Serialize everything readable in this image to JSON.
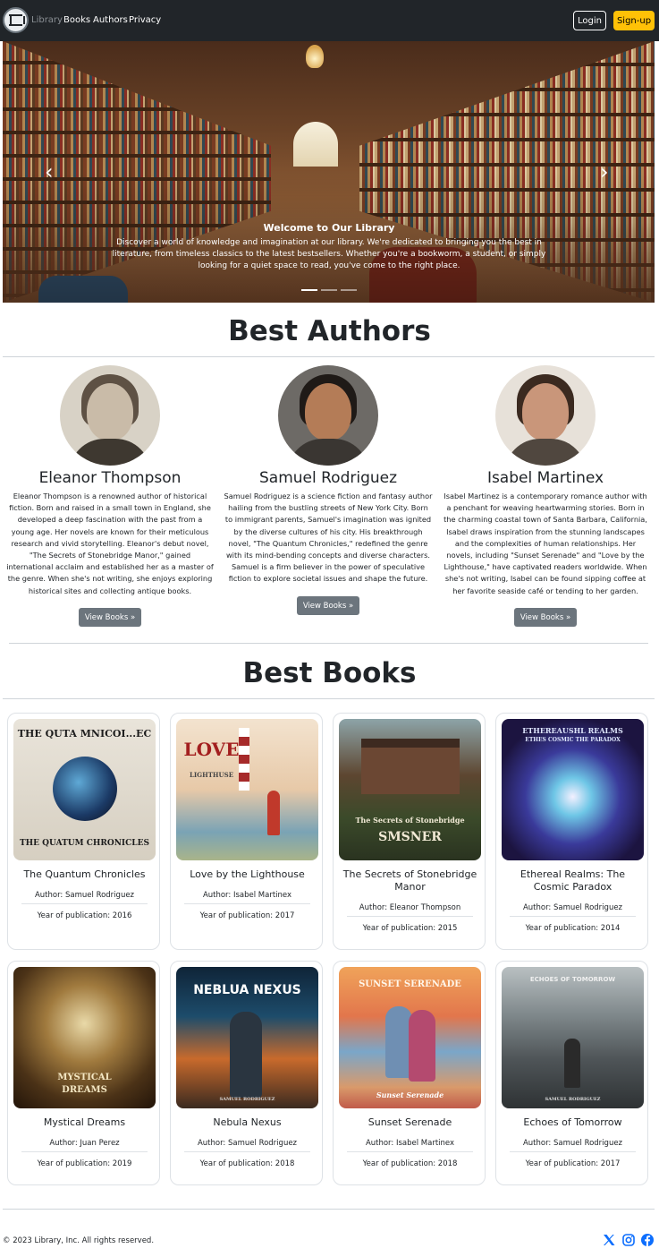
{
  "navbar": {
    "brand": "Library",
    "links": [
      "Books",
      "Authors",
      "Privacy"
    ],
    "login": "Login",
    "signup": "Sign-up"
  },
  "hero": {
    "title": "Welcome to Our Library",
    "text": "Discover a world of knowledge and imagination at our library. We're dedicated to bringing you the best in literature, from timeless classics to the latest bestsellers. Whether you're a bookworm, a student, or simply looking for a quiet space to read, you've come to the right place.",
    "prev_icon": "chevron-left-icon",
    "next_icon": "chevron-right-icon",
    "active_slide": 1,
    "slide_count": 3
  },
  "authors_section": {
    "title": "Best Authors",
    "authors": [
      {
        "name": "Eleanor Thompson",
        "bio": "Eleanor Thompson is a renowned author of historical fiction. Born and raised in a small town in England, she developed a deep fascination with the past from a young age. Her novels are known for their meticulous research and vivid storytelling. Eleanor's debut novel, \"The Secrets of Stonebridge Manor,\" gained international acclaim and established her as a master of the genre. When she's not writing, she enjoys exploring historical sites and collecting antique books.",
        "button": "View Books »"
      },
      {
        "name": "Samuel Rodriguez",
        "bio": "Samuel Rodriguez is a science fiction and fantasy author hailing from the bustling streets of New York City. Born to immigrant parents, Samuel's imagination was ignited by the diverse cultures of his city. His breakthrough novel, \"The Quantum Chronicles,\" redefined the genre with its mind-bending concepts and diverse characters. Samuel is a firm believer in the power of speculative fiction to explore societal issues and shape the future.",
        "button": "View Books »"
      },
      {
        "name": "Isabel Martinex",
        "bio": "Isabel Martinez is a contemporary romance author with a penchant for weaving heartwarming stories. Born in the charming coastal town of Santa Barbara, California, Isabel draws inspiration from the stunning landscapes and the complexities of human relationships. Her novels, including \"Sunset Serenade\" and \"Love by the Lighthouse,\" have captivated readers worldwide. When she's not writing, Isabel can be found sipping coffee at her favorite seaside café or tending to her garden.",
        "button": "View Books »"
      }
    ]
  },
  "books_section": {
    "title": "Best Books",
    "books": [
      {
        "title": "The Quantum Chronicles",
        "author": "Author: Samuel Rodriguez",
        "year": "Year of publication: 2016",
        "cover_text_top": "THE QUTA MNICOI...EC",
        "cover_text_bottom": "THE QUATUM CHRONICLES"
      },
      {
        "title": "Love by the Lighthouse",
        "author": "Author: Isabel Martinex",
        "year": "Year of publication: 2017",
        "cover_text_top": "LOVE",
        "cover_text_bottom": "LIGHTHUSE"
      },
      {
        "title": "The Secrets of Stonebridge Manor",
        "author": "Author: Eleanor Thompson",
        "year": "Year of publication: 2015",
        "cover_text_top": "The Secrets of Stonebridge",
        "cover_text_bottom": "SMSNER"
      },
      {
        "title": "Ethereal Realms: The Cosmic Paradox",
        "author": "Author: Samuel Rodriguez",
        "year": "Year of publication: 2014",
        "cover_text_top": "ETHEREAUSHL REALMS",
        "cover_text_bottom": "ETHES COSMIC THE PARADOX"
      },
      {
        "title": "Mystical Dreams",
        "author": "Author: Juan Perez",
        "year": "Year of publication: 2019",
        "cover_text_top": "MYSTICAL",
        "cover_text_bottom": "DREAMS"
      },
      {
        "title": "Nebula Nexus",
        "author": "Author: Samuel Rodriguez",
        "year": "Year of publication: 2018",
        "cover_text_top": "NEBLUA  NEXUS",
        "cover_text_bottom": "SAMUEL RODRIGUEZ"
      },
      {
        "title": "Sunset Serenade",
        "author": "Author: Isabel Martinex",
        "year": "Year of publication: 2018",
        "cover_text_top": "SUNSET SERENADE",
        "cover_text_bottom": "Sunset Serenade"
      },
      {
        "title": "Echoes of Tomorrow",
        "author": "Author: Samuel Rodriguez",
        "year": "Year of publication: 2017",
        "cover_text_top": "ECHOES OF TOMORROW",
        "cover_text_bottom": "SAMUEL RODRIGUEZ"
      }
    ]
  },
  "footer": {
    "copyright": "© 2023 Library, Inc. All rights reserved.",
    "social_icons": [
      "x-twitter-icon",
      "instagram-icon",
      "facebook-icon"
    ],
    "icon_color": "#0d6efd"
  },
  "colors": {
    "navbar_bg": "#212529",
    "signup_bg": "#ffc107",
    "view_button_bg": "#6c757d"
  }
}
